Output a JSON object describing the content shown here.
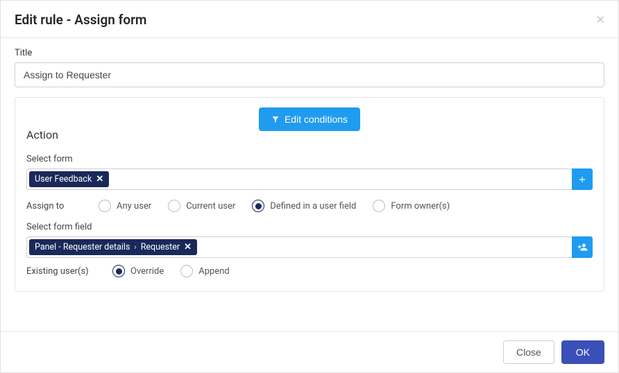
{
  "header": {
    "title": "Edit rule - Assign form"
  },
  "title_field": {
    "label": "Title",
    "value": "Assign to Requester"
  },
  "edit_conditions_label": "Edit conditions",
  "action": {
    "heading": "Action",
    "select_form": {
      "label": "Select form",
      "tag": "User Feedback"
    },
    "assign_to": {
      "label": "Assign to",
      "options": [
        "Any user",
        "Current user",
        "Defined in a user field",
        "Form owner(s)"
      ],
      "selected_index": 2
    },
    "select_form_field": {
      "label": "Select form field",
      "tag_prefix": "Panel - Requester details",
      "tag_suffix": "Requester"
    },
    "existing_users": {
      "label": "Existing user(s)",
      "options": [
        "Override",
        "Append"
      ],
      "selected_index": 0
    }
  },
  "footer": {
    "close": "Close",
    "ok": "OK"
  }
}
